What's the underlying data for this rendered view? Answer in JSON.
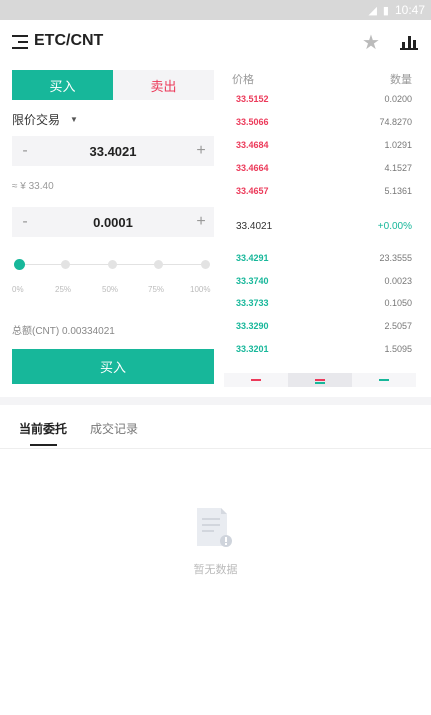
{
  "status_bar": {
    "time": "10:47"
  },
  "header": {
    "pair": "ETC/CNT"
  },
  "trade_tabs": {
    "buy": "买入",
    "sell": "卖出"
  },
  "order_type": {
    "label": "限价交易"
  },
  "price_input": {
    "minus": "-",
    "value": "33.4021",
    "plus": "+"
  },
  "approx_value": "≈ ¥ 33.40",
  "amount_input": {
    "minus": "-",
    "value": "0.0001",
    "plus": "+"
  },
  "slider": {
    "value_percent": 0,
    "labels": [
      "0%",
      "25%",
      "50%",
      "75%",
      "100%"
    ]
  },
  "total": "总额(CNT) 0.00334021",
  "submit_label": "买入",
  "order_book": {
    "price_header": "价格",
    "qty_header": "数量",
    "asks": [
      {
        "price": "33.5152",
        "qty": "0.0200"
      },
      {
        "price": "33.5066",
        "qty": "74.8270"
      },
      {
        "price": "33.4684",
        "qty": "1.0291"
      },
      {
        "price": "33.4664",
        "qty": "4.1527"
      },
      {
        "price": "33.4657",
        "qty": "5.1361"
      }
    ],
    "last_price": "33.4021",
    "change": "+0.00%",
    "bids": [
      {
        "price": "33.4291",
        "qty": "23.3555"
      },
      {
        "price": "33.3740",
        "qty": "0.0023"
      },
      {
        "price": "33.3733",
        "qty": "0.1050"
      },
      {
        "price": "33.3290",
        "qty": "2.5057"
      },
      {
        "price": "33.3201",
        "qty": "1.5095"
      }
    ]
  },
  "orders": {
    "tab_current": "当前委托",
    "tab_history": "成交记录",
    "empty_text": "暂无数据"
  },
  "colors": {
    "accent": "#17b79a",
    "sell": "#ec3a5a"
  }
}
